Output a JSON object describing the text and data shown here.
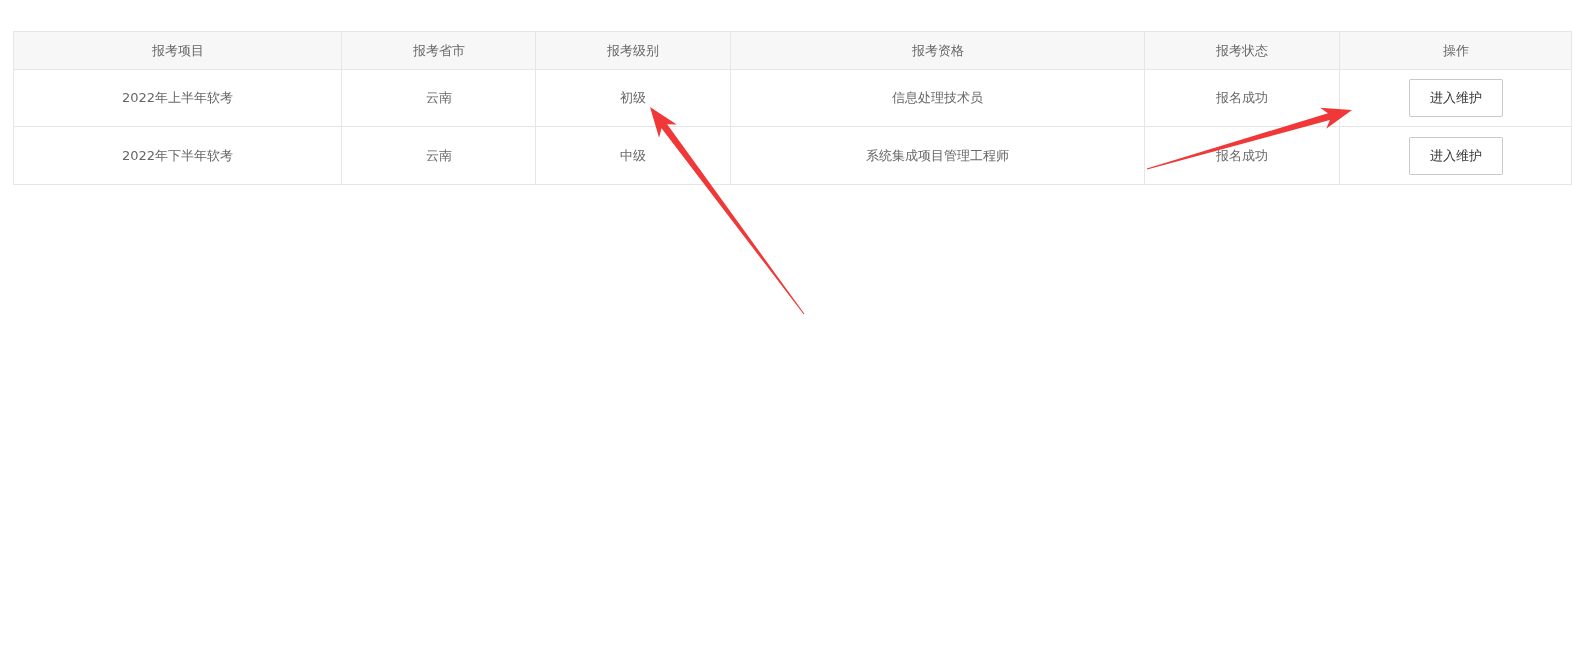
{
  "table": {
    "columns": [
      "报考项目",
      "报考省市",
      "报考级别",
      "报考资格",
      "报考状态",
      "操作"
    ],
    "rows": [
      {
        "cells": [
          "2022年上半年软考",
          "云南",
          "初级",
          "信息处理技术员",
          "报名成功"
        ],
        "action": "进入维护"
      },
      {
        "cells": [
          "2022年下半年软考",
          "云南",
          "中级",
          "系统集成项目管理工程师",
          "报名成功"
        ],
        "action": "进入维护"
      }
    ]
  }
}
